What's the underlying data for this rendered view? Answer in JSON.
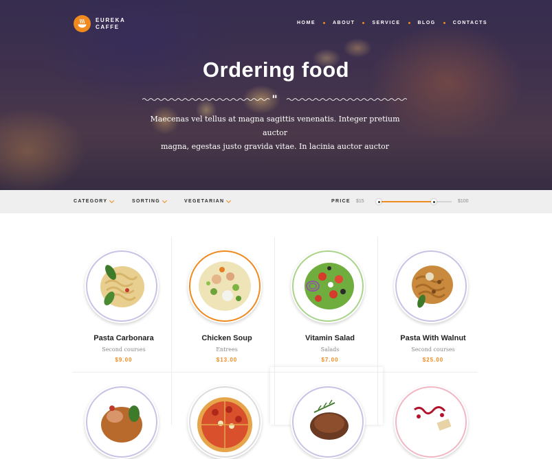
{
  "brand": {
    "name_line1": "EUREKA",
    "name_line2": "CAFFE",
    "logo_icon": "steaming-bowl-icon",
    "accent": "#f0891e"
  },
  "nav": [
    "HOME",
    "ABOUT",
    "SERVICE",
    "BLOG",
    "CONTACTS"
  ],
  "hero": {
    "title": "Ordering food",
    "text_line1": "Maecenas vel tellus at magna sagittis venenatis. Integer pretium auctor",
    "text_line2": "magna, egestas justo gravida vitae. In lacinia auctor auctor"
  },
  "filters": {
    "category": "CATEGORY",
    "sorting": "SORTING",
    "vegetarian": "VEGETARIAN"
  },
  "price_filter": {
    "label": "PRICE",
    "min": "$15",
    "max": "$100",
    "range_low_fraction": 0.0,
    "range_high_fraction": 0.8
  },
  "menu": [
    {
      "name": "Pasta Carbonara",
      "category": "Second courses",
      "price": "$9.00",
      "ring_color": "#c9c1e6"
    },
    {
      "name": "Chicken Soup",
      "category": "Entrees",
      "price": "$13.00",
      "ring_color": "#f0891e"
    },
    {
      "name": "Vitamin Salad",
      "category": "Salads",
      "price": "$7.00",
      "ring_color": "#a8d489"
    },
    {
      "name": "Pasta With Walnut",
      "category": "Second courses",
      "price": "$25.00",
      "ring_color": "#c9c1e6"
    },
    {
      "ring_color": "#c9c1e6"
    },
    {
      "ring_color": "#dcdcdc"
    },
    {
      "ring_color": "#c9c1e6"
    },
    {
      "ring_color": "#f2b6c3"
    }
  ]
}
